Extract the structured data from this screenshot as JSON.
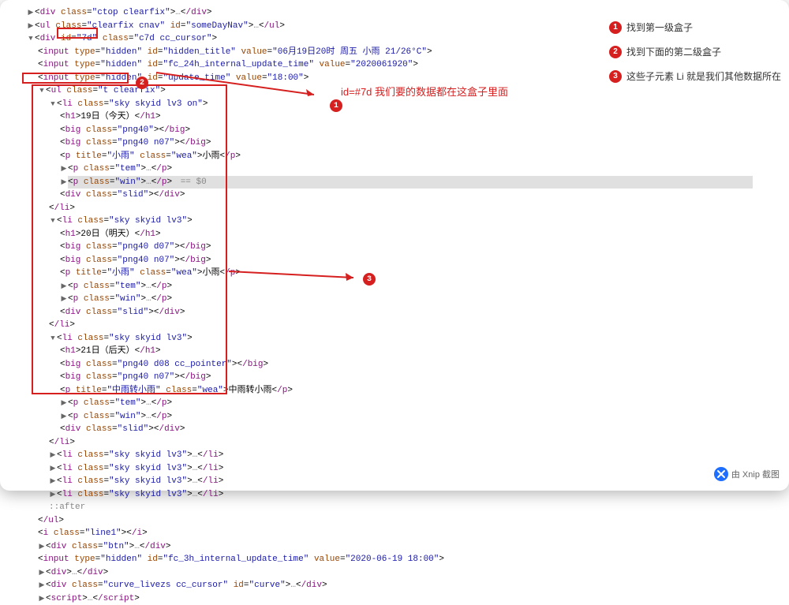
{
  "dom": {
    "l0": "<div class=\"ctop clearfix\">…</div>",
    "l1": "<ul class=\"clearfix cnav\" id=\"someDayNav\">…</ul>",
    "l2_open": "<div id=\"7d\" class=\"c7d cc_cursor\">",
    "l3": "<input type=\"hidden\" id=\"hidden_title\" value=\"06月19日20时 周五   小雨  21/26°C\">",
    "l4": "<input type=\"hidden\" id=\"fc_24h_internal_update_time\" value=\"2020061920\">",
    "l5": "<input type=\"hidden\" id=\"update_time\" value=\"18:00\">",
    "l6_open": "<ul class=\"t clearfix\">",
    "li1_open": "<li class=\"sky skyid lv3 on\">",
    "li1_h1": "<h1>19日（今天）</h1>",
    "li1_big1": "<big class=\"png40\"></big>",
    "li1_big2": "<big class=\"png40 n07\"></big>",
    "li1_p_wea": "<p title=\"小雨\" class=\"wea\">小雨</p>",
    "li1_p_tem": "<p class=\"tem\">…</p>",
    "li1_p_win": "<p class=\"win\">…</p>",
    "li1_eq": " == $0",
    "li1_slid": "<div class=\"slid\"></div>",
    "li_close": "</li>",
    "li2_open": "<li class=\"sky skyid lv3\">",
    "li2_h1": "<h1>20日（明天）</h1>",
    "li2_big1": "<big class=\"png40 d07\"></big>",
    "li2_big2": "<big class=\"png40 n07\"></big>",
    "li2_p_wea": "<p title=\"小雨\" class=\"wea\">小雨</p>",
    "li2_p_tem": "<p class=\"tem\">…</p>",
    "li2_p_win": "<p class=\"win\">…</p>",
    "li2_slid": "<div class=\"slid\"></div>",
    "li3_open": "<li class=\"sky skyid lv3\">",
    "li3_h1": "<h1>21日（后天）</h1>",
    "li3_big1": "<big class=\"png40 d08 cc_pointer\"></big>",
    "li3_big2": "<big class=\"png40 n07\"></big>",
    "li3_p_wea": "<p title=\"中雨转小雨\" class=\"wea\">中雨转小雨</p>",
    "li3_p_tem": "<p class=\"tem\">…</p>",
    "li3_p_win": "<p class=\"win\">…</p>",
    "li3_slid": "<div class=\"slid\"></div>",
    "li4": "<li class=\"sky skyid lv3\">…</li>",
    "li5": "<li class=\"sky skyid lv3\">…</li>",
    "li6": "<li class=\"sky skyid lv3\">…</li>",
    "li7": "<li class=\"sky skyid lv3\">…</li>",
    "after": "::after",
    "ul_close": "</ul>",
    "line1": "<i class=\"line1\"></i>",
    "btn": "<div class=\"btn\">…</div>",
    "fc3h": "<input type=\"hidden\" id=\"fc_3h_internal_update_time\" value=\"2020-06-19 18:00\">",
    "div_empty": "<div>…</div>",
    "curve": "<div class=\"curve_livezs cc_cursor\" id=\"curve\">…</div>",
    "script": "<script>…</script>"
  },
  "annotations": {
    "a1": "id=#7d 我们要的数据都在这盒子里面",
    "note1": "找到第一级盒子",
    "note2": "找到下面的第二级盒子",
    "note3": "这些子元素 Li 就是我们其他数据所在"
  },
  "watermark": "由 Xnip 截图"
}
